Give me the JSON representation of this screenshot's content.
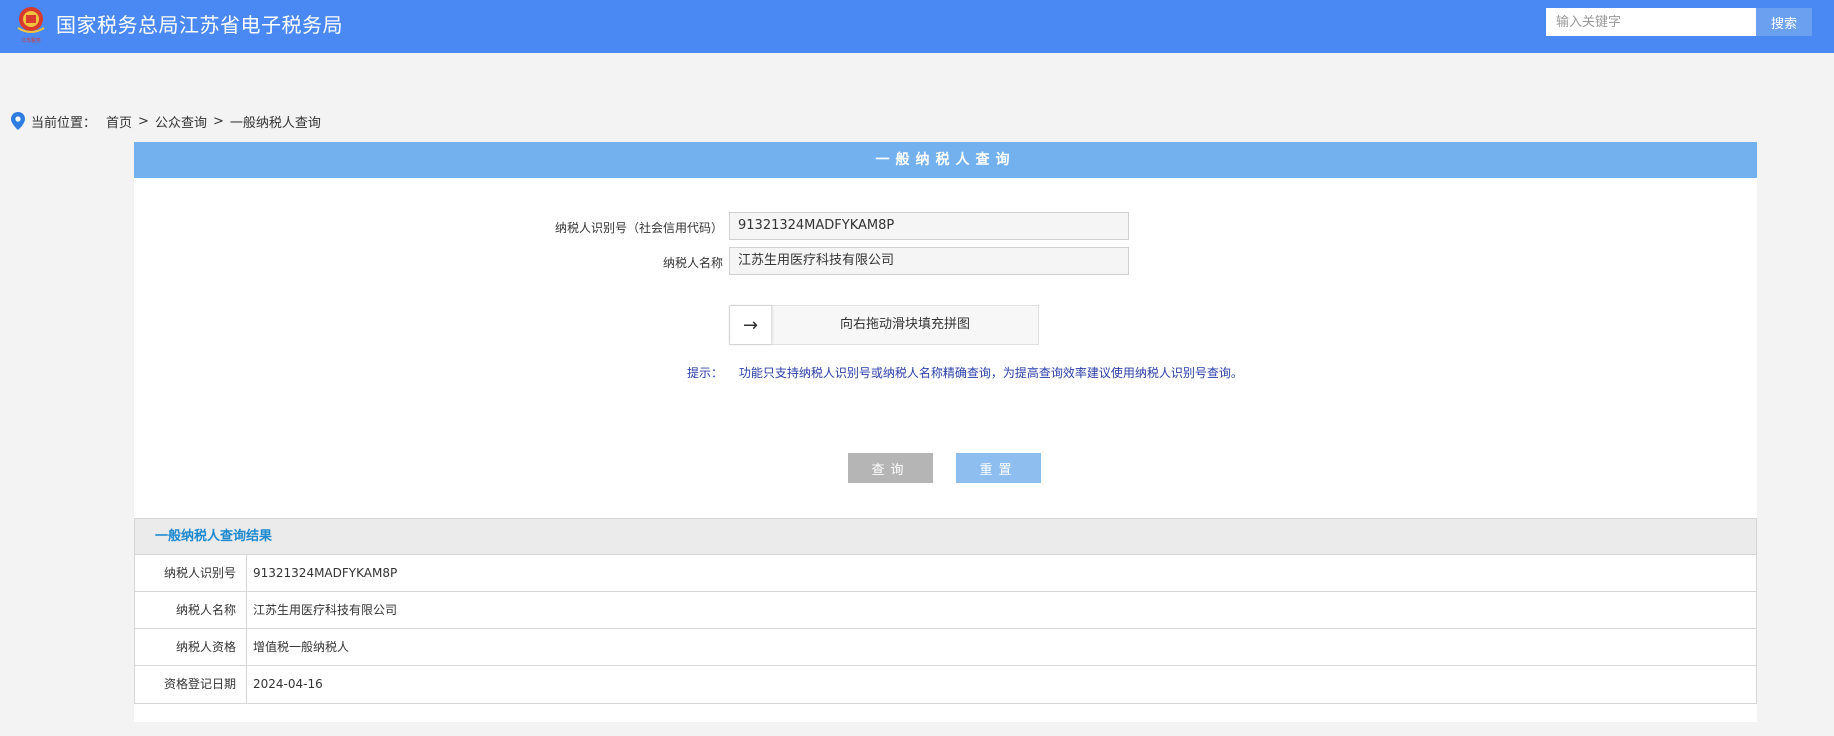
{
  "header": {
    "site_title": "国家税务总局江苏省电子税务局",
    "logo_text": "江苏税务",
    "search_placeholder": "输入关键字",
    "search_button": "搜索",
    "colors": {
      "bar": "#4a89f3",
      "button": "#6b9ff0"
    }
  },
  "breadcrumb": {
    "label": "当前位置：",
    "items": [
      "首页",
      "公众查询",
      "一般纳税人查询"
    ],
    "separator": ">"
  },
  "panel": {
    "title": "一般纳税人查询",
    "form": {
      "taxpayer_id_label": "纳税人识别号（社会信用代码）",
      "taxpayer_id_value": "91321324MADFYKAM8P",
      "taxpayer_name_label": "纳税人名称",
      "taxpayer_name_value": "江苏生用医疗科技有限公司"
    },
    "slider": {
      "icon": "arrow-right-icon",
      "text": "向右拖动滑块填充拼图"
    },
    "hint": {
      "label": "提示：",
      "text": "功能只支持纳税人识别号或纳税人名称精确查询，为提高查询效率建议使用纳税人识别号查询。"
    },
    "buttons": {
      "query": "查询",
      "reset": "重置"
    }
  },
  "result": {
    "title": "一般纳税人查询结果",
    "rows": [
      {
        "key": "纳税人识别号",
        "value": "91321324MADFYKAM8P"
      },
      {
        "key": "纳税人名称",
        "value": "江苏生用医疗科技有限公司"
      },
      {
        "key": "纳税人资格",
        "value": "增值税一般纳税人"
      },
      {
        "key": "资格登记日期",
        "value": "2024-04-16"
      }
    ],
    "colors": {
      "title": "#1d8ad0",
      "header_bg": "#ebebeb"
    }
  }
}
